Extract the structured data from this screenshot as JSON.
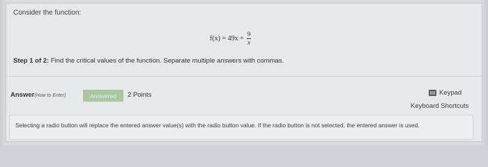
{
  "question": {
    "prompt": "Consider the function:",
    "function": {
      "lhs": "f(x) = 49x +",
      "fraction_numerator": "9",
      "fraction_denominator": "x"
    },
    "step_label": "Step 1 of 2:",
    "step_text": "Find the critical values of the function. Separate multiple answers with commas."
  },
  "answer_bar": {
    "label": "Answer",
    "how_to": "(How to Enter)",
    "status_button": "Answered",
    "points": "2 Points",
    "keypad": "Keypad",
    "keyboard_shortcuts": "Keyboard Shortcuts"
  },
  "notice": "Selecting a radio button will replace the entered answer value(s) with the radio button value. If the radio button is not selected, the entered answer is used.",
  "colors": {
    "answered_bg": "#a9c7a3",
    "card_bg": "#e6e8ea"
  },
  "icons": {
    "keypad": "keypad-icon"
  }
}
